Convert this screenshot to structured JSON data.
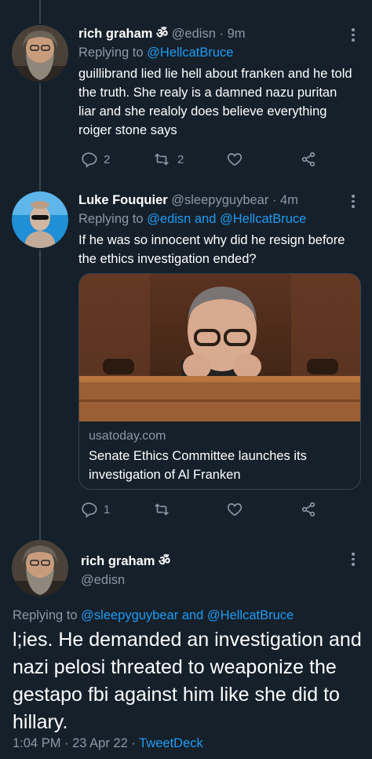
{
  "tweets": [
    {
      "name": "rich graham ॐ",
      "handle": "@edisn",
      "sep": "·",
      "time": "9m",
      "replying_prefix": "Replying to",
      "replying_to": "@HellcatBruce",
      "text": "guillibrand lied lie hell about franken and he told the truth. She realy is a damned nazu puritan liar and she realoly does believe everything roiger stone says",
      "reply_count": "2",
      "retweet_count": "2",
      "like_count": ""
    },
    {
      "name": "Luke Fouquier",
      "handle": "@sleepyguybear",
      "sep": "·",
      "time": "4m",
      "replying_prefix": "Replying to",
      "replying_to": "@edisn and @HellcatBruce",
      "text": "If he was so innocent why did he resign before the ethics investigation ended?",
      "card": {
        "domain": "usatoday.com",
        "title": "Senate Ethics Committee launches its investigation of Al Franken"
      },
      "reply_count": "1",
      "retweet_count": "",
      "like_count": ""
    }
  ],
  "main_tweet": {
    "name": "rich graham ॐ",
    "handle": "@edisn",
    "replying_prefix": "Replying to",
    "replying_to": "@sleepyguybear and @HellcatBruce",
    "text": "l;ies. He demanded an investigation and nazi pelosi threated to weaponize the gestapo fbi against him like she did to hillary.",
    "timestamp": "1:04 PM · 23 Apr 22 ·",
    "source": "TweetDeck"
  },
  "icons": [
    "reply-icon",
    "retweet-icon",
    "like-icon",
    "share-icon",
    "more-icon"
  ],
  "colors": {
    "background": "#15202b",
    "link": "#1d9bf0",
    "secondary_text": "#8b98a5",
    "divider": "#38444d"
  }
}
